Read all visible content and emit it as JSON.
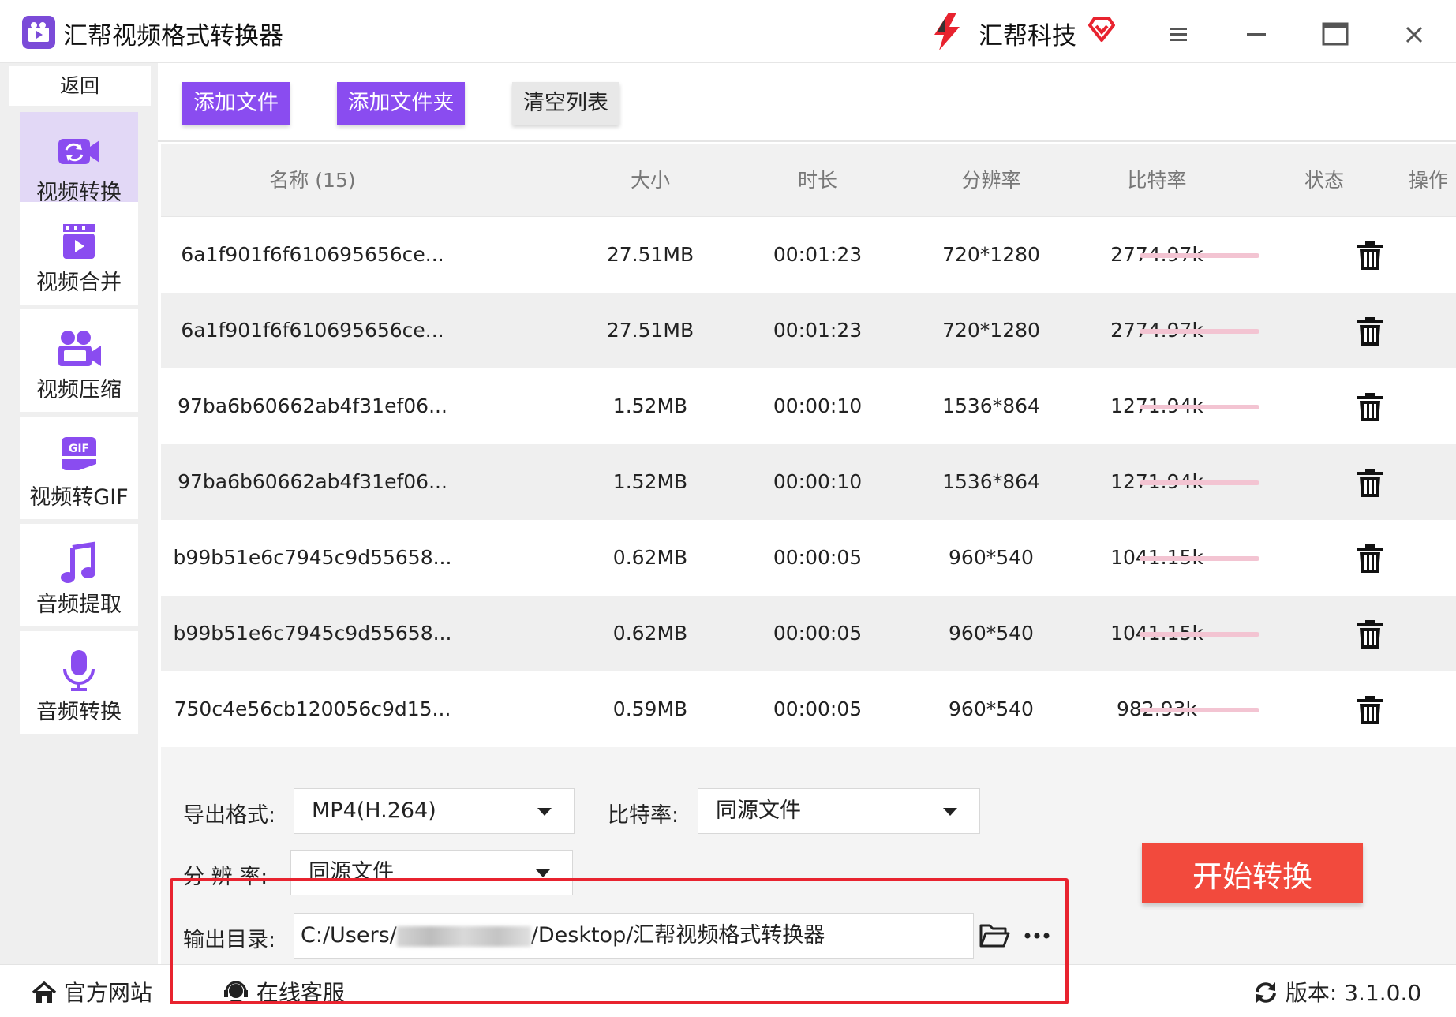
{
  "window": {
    "title": "汇帮视频格式转换器",
    "brand": "汇帮科技"
  },
  "sidebar": {
    "back_label": "返回",
    "items": [
      {
        "label": "视频转换",
        "icon": "video-convert-icon"
      },
      {
        "label": "视频合并",
        "icon": "video-merge-icon"
      },
      {
        "label": "视频压缩",
        "icon": "video-compress-icon"
      },
      {
        "label": "视频转GIF",
        "icon": "gif-icon"
      },
      {
        "label": "音频提取",
        "icon": "music-note-icon"
      },
      {
        "label": "音频转换",
        "icon": "microphone-icon"
      }
    ]
  },
  "toolbar": {
    "add_file": "添加文件",
    "add_folder": "添加文件夹",
    "clear_list": "清空列表"
  },
  "table": {
    "headers": {
      "name": "名称 (15)",
      "size": "大小",
      "duration": "时长",
      "resolution": "分辨率",
      "bitrate": "比特率",
      "status": "状态",
      "action": "操作"
    },
    "rows": [
      {
        "name": "6a1f901f6f610695656ce...",
        "size": "27.51MB",
        "duration": "00:01:23",
        "resolution": "720*1280",
        "bitrate": "2774.97k"
      },
      {
        "name": "6a1f901f6f610695656ce...",
        "size": "27.51MB",
        "duration": "00:01:23",
        "resolution": "720*1280",
        "bitrate": "2774.97k"
      },
      {
        "name": "97ba6b60662ab4f31ef06...",
        "size": "1.52MB",
        "duration": "00:00:10",
        "resolution": "1536*864",
        "bitrate": "1271.94k"
      },
      {
        "name": "97ba6b60662ab4f31ef06...",
        "size": "1.52MB",
        "duration": "00:00:10",
        "resolution": "1536*864",
        "bitrate": "1271.94k"
      },
      {
        "name": "b99b51e6c7945c9d55658...",
        "size": "0.62MB",
        "duration": "00:00:05",
        "resolution": "960*540",
        "bitrate": "1041.15k"
      },
      {
        "name": "b99b51e6c7945c9d55658...",
        "size": "0.62MB",
        "duration": "00:00:05",
        "resolution": "960*540",
        "bitrate": "1041.15k"
      },
      {
        "name": "750c4e56cb120056c9d15...",
        "size": "0.59MB",
        "duration": "00:00:05",
        "resolution": "960*540",
        "bitrate": "982.93k"
      }
    ]
  },
  "settings": {
    "format_label": "导出格式:",
    "format_value": "MP4(H.264)",
    "bitrate_label": "比特率:",
    "bitrate_value": "同源文件",
    "resolution_label": "分 辨 率:",
    "resolution_value": "同源文件",
    "output_label": "输出目录:",
    "output_prefix": "C:/Users/",
    "output_suffix": "/Desktop/汇帮视频格式转换器",
    "start_button": "开始转换"
  },
  "footer": {
    "website": "官方网站",
    "support": "在线客服",
    "version": "版本: 3.1.0.0"
  },
  "colors": {
    "accent_purple": "#8a4cf0",
    "start_red": "#f24a3d",
    "highlight_red": "#e8232f",
    "status_pink": "#f3c4d2"
  }
}
